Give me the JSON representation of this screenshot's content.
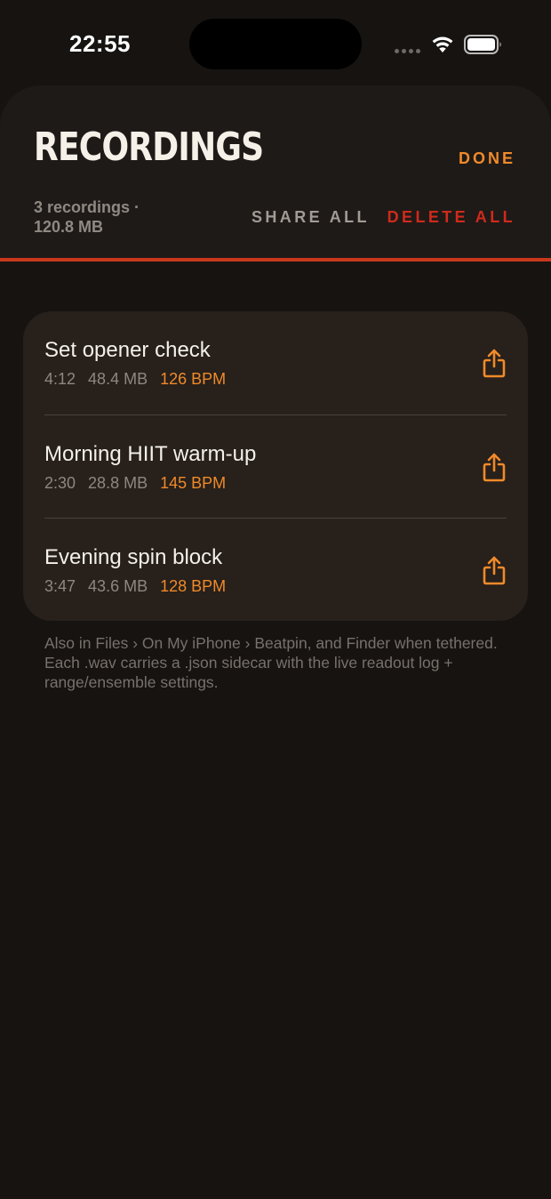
{
  "status_bar": {
    "time": "22:55"
  },
  "header": {
    "title": "RECORDINGS",
    "done_label": "DONE",
    "summary_line1": "3 recordings ·",
    "summary_line2": "120.8 MB",
    "share_all_label": "SHARE ALL",
    "delete_all_label": "DELETE ALL"
  },
  "recordings": [
    {
      "title": "Set opener check",
      "duration": "4:12",
      "size": "48.4 MB",
      "bpm": "126 BPM"
    },
    {
      "title": "Morning HIIT warm-up",
      "duration": "2:30",
      "size": "28.8 MB",
      "bpm": "145 BPM"
    },
    {
      "title": "Evening spin block",
      "duration": "3:47",
      "size": "43.6 MB",
      "bpm": "128 BPM"
    }
  ],
  "footnote": "Also in Files › On My iPhone › Beatpin, and Finder when tethered. Each .wav carries a .json sidecar with the live readout log + range/ensemble settings.",
  "icons": {
    "share": "share-icon",
    "wifi": "wifi-icon",
    "battery": "battery-icon"
  },
  "colors": {
    "accent": "#f08a2a",
    "danger": "#cf2a1c",
    "rule": "#c8381b",
    "background": "#161311",
    "card": "#27201b"
  }
}
